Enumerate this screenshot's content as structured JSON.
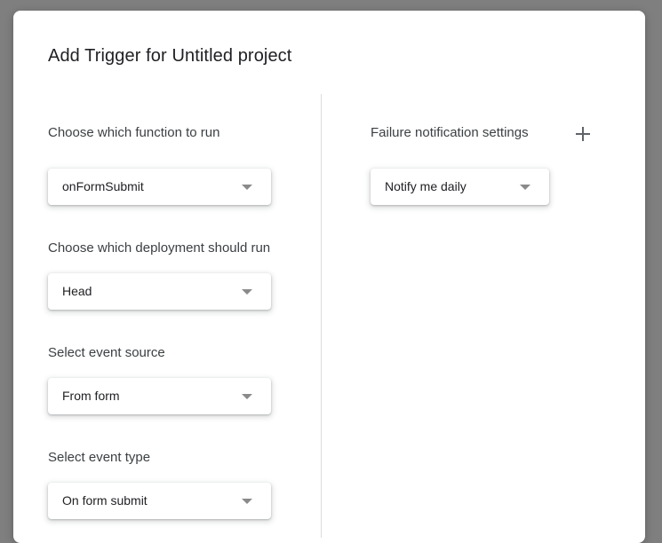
{
  "dialog": {
    "title": "Add Trigger for Untitled project"
  },
  "left_column": {
    "function": {
      "label": "Choose which function to run",
      "value": "onFormSubmit"
    },
    "deployment": {
      "label": "Choose which deployment should run",
      "value": "Head"
    },
    "event_source": {
      "label": "Select event source",
      "value": "From form"
    },
    "event_type": {
      "label": "Select event type",
      "value": "On form submit"
    }
  },
  "right_column": {
    "failure_notification": {
      "label": "Failure notification settings",
      "value": "Notify me daily",
      "add_icon": "plus-icon"
    }
  }
}
